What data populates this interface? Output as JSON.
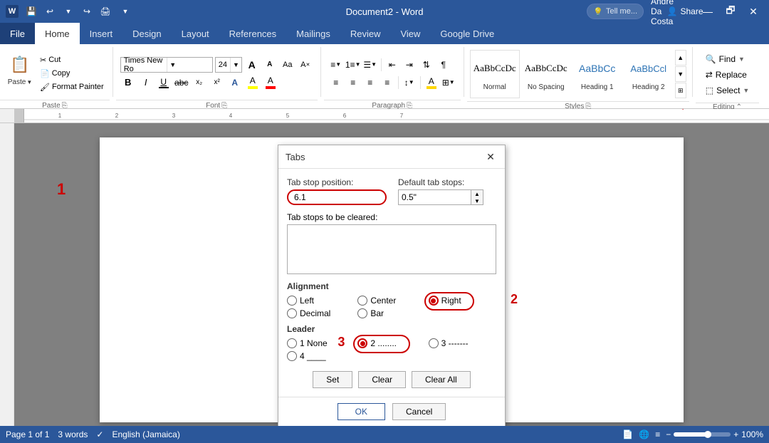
{
  "titleBar": {
    "title": "Document2 - Word",
    "minimize": "🗕",
    "restore": "🗗",
    "close": "✕",
    "quickAccess": [
      "💾",
      "↩",
      "↪",
      "🖨",
      "⬛",
      "▼"
    ]
  },
  "ribbonTabs": [
    {
      "label": "File",
      "active": false
    },
    {
      "label": "Home",
      "active": true
    },
    {
      "label": "Insert",
      "active": false
    },
    {
      "label": "Design",
      "active": false
    },
    {
      "label": "Layout",
      "active": false
    },
    {
      "label": "References",
      "active": false
    },
    {
      "label": "Mailings",
      "active": false
    },
    {
      "label": "Review",
      "active": false
    },
    {
      "label": "View",
      "active": false
    },
    {
      "label": "Google Drive",
      "active": false
    }
  ],
  "tellMe": "Tell me...",
  "userInfo": "Andre Da Costa",
  "share": "Share",
  "font": {
    "family": "Times New Ro",
    "size": "24",
    "growLabel": "A",
    "shrinkLabel": "A",
    "caseLabel": "Aa",
    "clearLabel": "A",
    "boldLabel": "B",
    "italicLabel": "I",
    "underlineLabel": "U",
    "strikeLabel": "abc",
    "subscript": "x₂",
    "superscript": "x²",
    "fontColorLabel": "A",
    "highlightLabel": "A"
  },
  "styles": [
    {
      "label": "¶ Normal",
      "name": "Normal"
    },
    {
      "label": "¶ No Spac...",
      "name": "No Spacing"
    },
    {
      "label": "Heading 1",
      "name": "Heading 1"
    },
    {
      "label": "Heading 2",
      "name": "Heading 2"
    }
  ],
  "editing": {
    "find": "Find",
    "replace": "Replace",
    "select": "Select"
  },
  "clipboard": {
    "paste": "Paste",
    "cut": "Cut",
    "copy": "Copy",
    "formatPainter": "Format Painter"
  },
  "paragraph": {
    "label": "Paragraph"
  },
  "dialog": {
    "title": "Tabs",
    "tabStopPositionLabel": "Tab stop position:",
    "tabStopPositionValue": "6.1",
    "defaultTabStopLabel": "Default tab stops:",
    "defaultTabStopValue": "0.5\"",
    "tabStopsToClearLabel": "Tab stops to be cleared:",
    "alignmentLabel": "Alignment",
    "alignments": [
      {
        "label": "Left",
        "checked": false
      },
      {
        "label": "Center",
        "checked": false
      },
      {
        "label": "Right",
        "checked": true
      },
      {
        "label": "Decimal",
        "checked": false
      },
      {
        "label": "Bar",
        "checked": false
      }
    ],
    "leaderLabel": "Leader",
    "leaders": [
      {
        "label": "1 None",
        "checked": false
      },
      {
        "label": "2 ........",
        "checked": true
      },
      {
        "label": "3 -------",
        "checked": false
      },
      {
        "label": "4 ____",
        "checked": false
      }
    ],
    "buttons": {
      "set": "Set",
      "clear": "Clear",
      "clearAll": "Clear All",
      "ok": "OK",
      "cancel": "Cancel"
    }
  },
  "annotations": {
    "num1": "1",
    "num2": "2",
    "num3": "3"
  },
  "statusBar": {
    "page": "Page 1 of 1",
    "words": "3 words",
    "language": "English (Jamaica)",
    "zoom": "100%"
  }
}
